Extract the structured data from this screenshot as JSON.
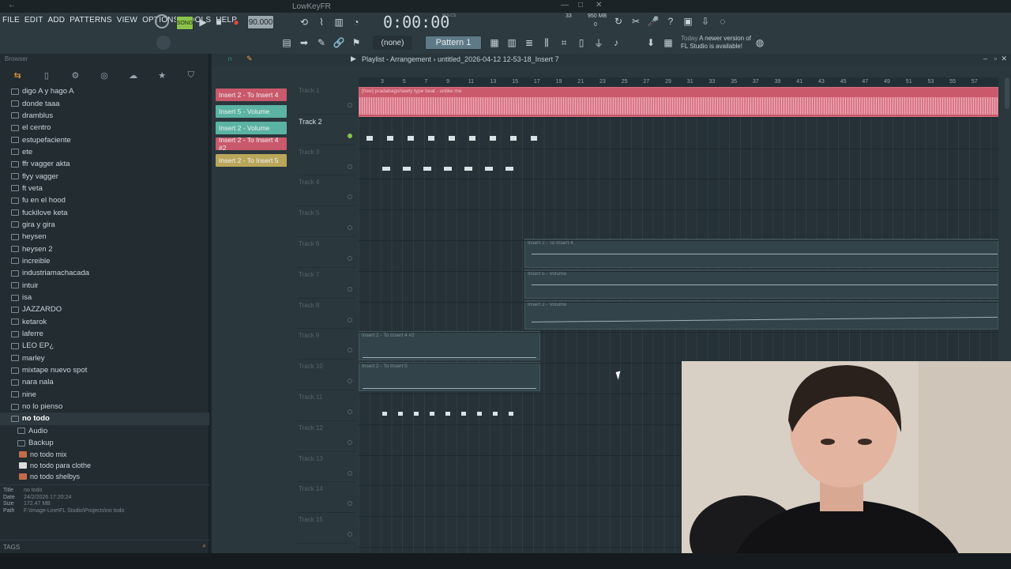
{
  "window": {
    "title": "LowKeyFR"
  },
  "menu": [
    "FILE",
    "EDIT",
    "ADD",
    "PATTERNS",
    "VIEW",
    "OPTIONS",
    "TOOLS",
    "HELP"
  ],
  "transport": {
    "mode": "SONG",
    "tempo": "90.000",
    "time": "0:00:00",
    "time_label": "M:S:CS",
    "cpu": "33",
    "memory": "950 MB",
    "voices": "0"
  },
  "pattern": {
    "none_label": "(none)",
    "pattern_name": "Pattern 1"
  },
  "hint": {
    "label": "Today",
    "text": "A newer version of FL Studio is available!"
  },
  "browser": {
    "title": "Browser",
    "items": [
      "digo A y hago A",
      "donde taaa",
      "dramblus",
      "el centro",
      "estupefaciente",
      "ete",
      "ffr vagger akta",
      "flyy vagger",
      "ft veta",
      "fu en el hood",
      "fuckilove keta",
      "gira y gira",
      "heysen",
      "heysen 2",
      "increible",
      "industriamachacada",
      "intuir",
      "isa",
      "JAZZARDO",
      "ketarok",
      "laferre",
      "LEO EP¿",
      "marley",
      "mixtape nuevo spot",
      "nara nala",
      "nine",
      "no lo pienso"
    ],
    "selected": "no todo",
    "subfolders": [
      "Audio",
      "Backup"
    ],
    "files": [
      "no todo mix",
      "no todo para clothe",
      "no todo shelbys"
    ],
    "info": {
      "title_label": "Title",
      "title": "no todo",
      "date_label": "Date",
      "date": "24/2/2026 17:20:24",
      "size_label": "Size",
      "size": "172.47 MB",
      "path_label": "Path",
      "path": "F:\\Image-Line\\FL Studio\\Projects\\no todo"
    },
    "tags_label": "TAGS"
  },
  "playlist": {
    "title": "Playlist - Arrangement › untitled_2026-04-12 12-53-18_Insert 7",
    "clip_sources": [
      {
        "label": "Insert 2 - To Insert 4",
        "color": "#c9596b"
      },
      {
        "label": "Insert 5 - Volume",
        "color": "#5bb3a3"
      },
      {
        "label": "Insert 2 - Volume",
        "color": "#5bb3a3"
      },
      {
        "label": "Insert 2 - To Insert 4 #2",
        "color": "#c9596b"
      },
      {
        "label": "Insert 2 - To Insert 5",
        "color": "#b9a65a"
      }
    ],
    "tracks": [
      "Track 1",
      "Track 2",
      "Track 3",
      "Track 4",
      "Track 5",
      "Track 6",
      "Track 7",
      "Track 8",
      "Track 9",
      "Track 10",
      "Track 11",
      "Track 12",
      "Track 13",
      "Track 14",
      "Track 15"
    ],
    "active_track": "Track 2",
    "timeline": [
      "3",
      "5",
      "7",
      "9",
      "11",
      "13",
      "15",
      "17",
      "19",
      "21",
      "23",
      "25",
      "27",
      "29",
      "31",
      "33",
      "35",
      "37",
      "39",
      "41",
      "43",
      "45",
      "47",
      "49",
      "51",
      "53",
      "55",
      "57"
    ],
    "audio_clip": "[free] pradabagshawty type beat - unlike me",
    "auto_clips": [
      "Insert 2 - To Insert 4",
      "Insert 5 - Volume",
      "Insert 2 - Volume",
      "Insert 2 - To Insert 4 #2",
      "Insert 2 - To Insert 5"
    ]
  }
}
